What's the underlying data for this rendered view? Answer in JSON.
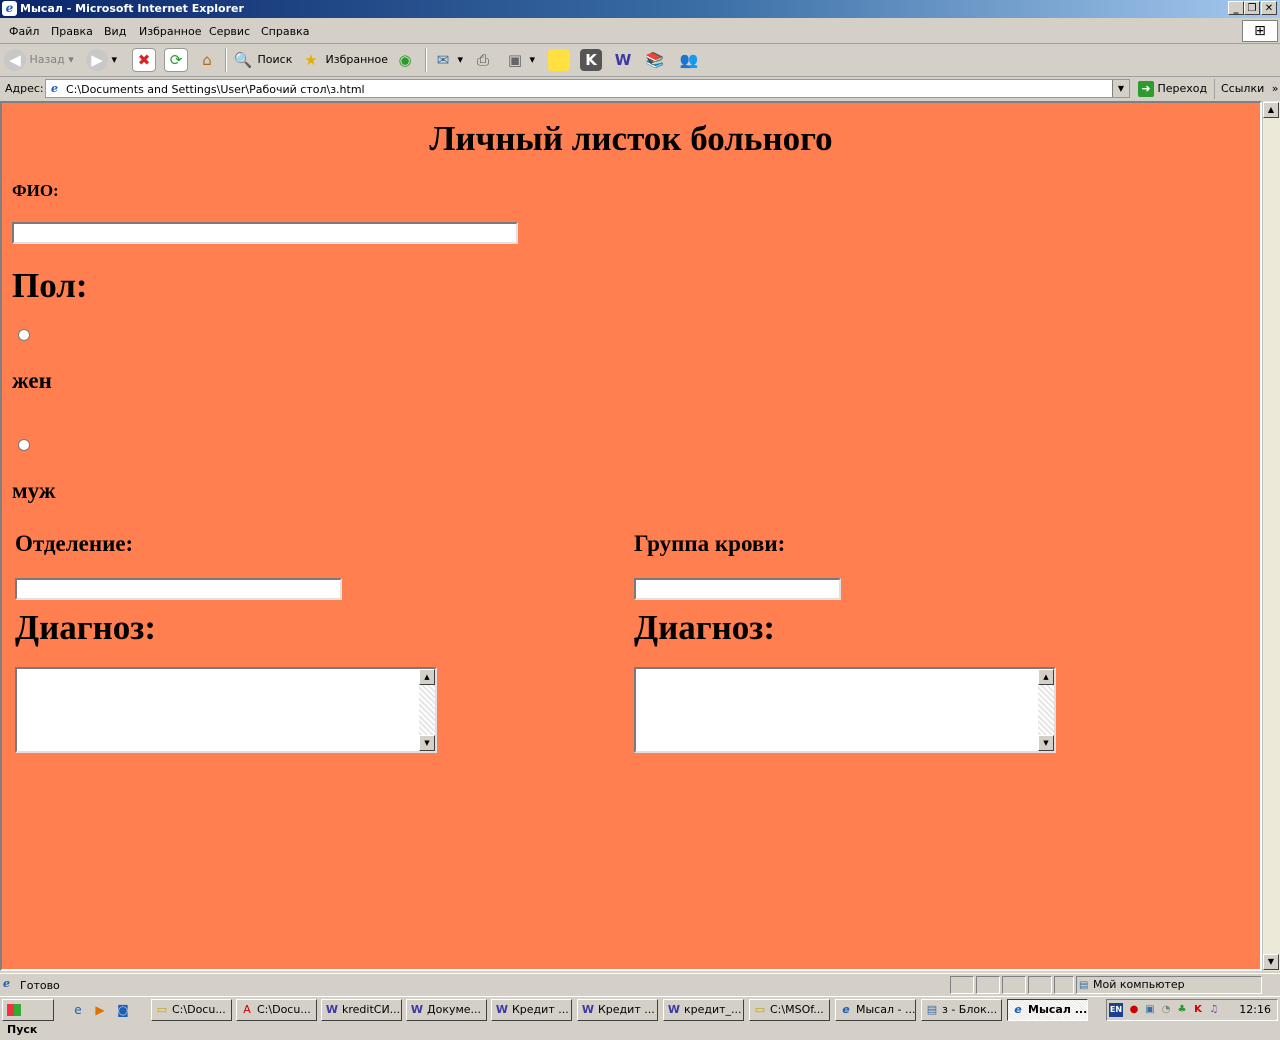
{
  "window": {
    "title": "Мысал - Microsoft Internet Explorer"
  },
  "menu": [
    "Файл",
    "Правка",
    "Вид",
    "Избранное",
    "Сервис",
    "Справка"
  ],
  "toolbar": {
    "back": "Назад",
    "search": "Поиск",
    "favorites": "Избранное"
  },
  "address": {
    "label": "Адрес:",
    "url": "C:\\Documents and Settings\\User\\Рабочий стол\\з.html",
    "go": "Переход",
    "links": "Ссылки"
  },
  "page": {
    "background": "#ff7f50",
    "title": "Личный листок больного",
    "fio_label": "ФИО:",
    "fio_value": "",
    "sex_label": "Пол:",
    "female": "жен",
    "male": "муж",
    "department_label": "Отделение:",
    "department_value": "",
    "blood_label": "Группа крови:",
    "blood_value": "",
    "diagnosis_label_1": "Диагноз:",
    "diagnosis_label_2": "Диагноз:",
    "diagnosis_value_1": "",
    "diagnosis_value_2": ""
  },
  "status": {
    "text": "Готово",
    "zone": "Мой компьютер"
  },
  "taskbar": {
    "start": "Пуск",
    "tasks": [
      {
        "label": "C:\\Docu...",
        "icon": "folder-icon"
      },
      {
        "label": "C:\\Docu...",
        "icon": "acrobat-icon"
      },
      {
        "label": "kreditСИ...",
        "icon": "word-icon"
      },
      {
        "label": "Докуме...",
        "icon": "word-icon"
      },
      {
        "label": "Кредит ...",
        "icon": "word-icon"
      },
      {
        "label": "Кредит ...",
        "icon": "word-icon"
      },
      {
        "label": "кредит_...",
        "icon": "word-icon"
      },
      {
        "label": "C:\\MSOf...",
        "icon": "folder-icon"
      },
      {
        "label": "Мысал - ...",
        "icon": "ie-icon"
      },
      {
        "label": "з - Блок...",
        "icon": "notepad-icon"
      },
      {
        "label": "Мысал ...",
        "icon": "ie-icon"
      }
    ],
    "lang": "EN",
    "clock": "12:16"
  }
}
